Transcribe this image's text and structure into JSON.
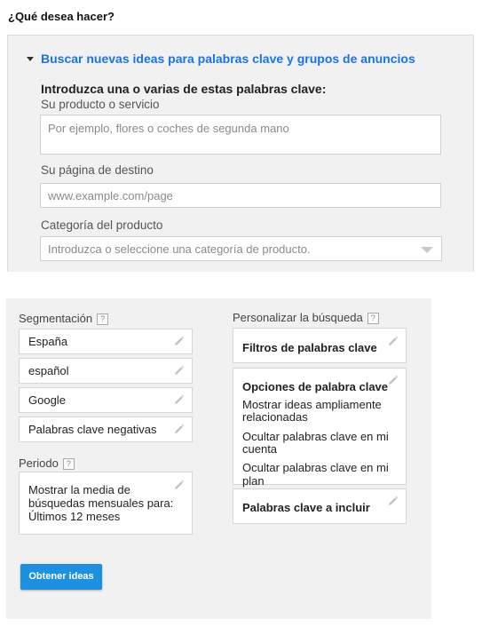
{
  "question": "¿Qué desea hacer?",
  "idea_section": {
    "expand_title": "Buscar nuevas ideas para palabras clave y grupos de anuncios",
    "intro_heading": "Introduzca una o varias de estas palabras clave:",
    "product_label": "Su producto o servicio",
    "product_placeholder": "Por ejemplo, flores o coches de segunda mano",
    "landing_label": "Su página de destino",
    "landing_placeholder": "www.example.com/page",
    "category_label": "Categoría del producto",
    "category_placeholder": "Introduzca o seleccione una categoría de producto."
  },
  "targeting": {
    "label": "Segmentación",
    "help": "?",
    "items": [
      {
        "label": "España"
      },
      {
        "label": "español"
      },
      {
        "label": "Google"
      },
      {
        "label": "Palabras clave negativas"
      }
    ]
  },
  "period": {
    "label": "Periodo",
    "help": "?",
    "line1": "Mostrar la media de",
    "line2": "búsquedas mensuales para:",
    "line3": "Últimos 12 meses"
  },
  "customize": {
    "label": "Personalizar la búsqueda",
    "help": "?",
    "filters_title": "Filtros de palabras clave",
    "options_title": "Opciones de palabra clave",
    "option1_line1": "Mostrar ideas ampliamente",
    "option1_line2": "relacionadas",
    "option2_line1": "Ocultar palabras clave en mi",
    "option2_line2": "cuenta",
    "option3": "Ocultar palabras clave en mi plan",
    "include_title": "Palabras clave a incluir"
  },
  "get_ideas_button": "Obtener ideas",
  "colors": {
    "link_blue": "#1a73e8",
    "button_blue": "#1e90e0",
    "panel_bg": "#f1f1f1"
  }
}
